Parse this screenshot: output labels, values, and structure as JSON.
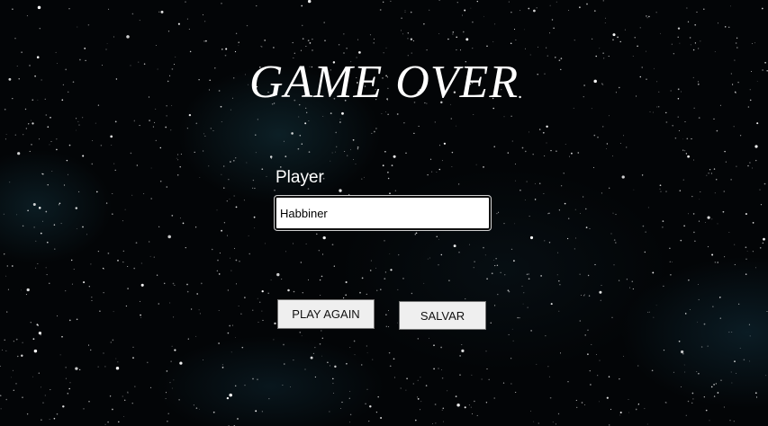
{
  "title": "GAME OVER",
  "player": {
    "label": "Player",
    "value": "Habbiner"
  },
  "buttons": {
    "play_again": "PLAY AGAIN",
    "save": "SALVAR"
  },
  "colors": {
    "background": "#030507",
    "text": "#ffffff",
    "button_bg": "#efefef"
  }
}
